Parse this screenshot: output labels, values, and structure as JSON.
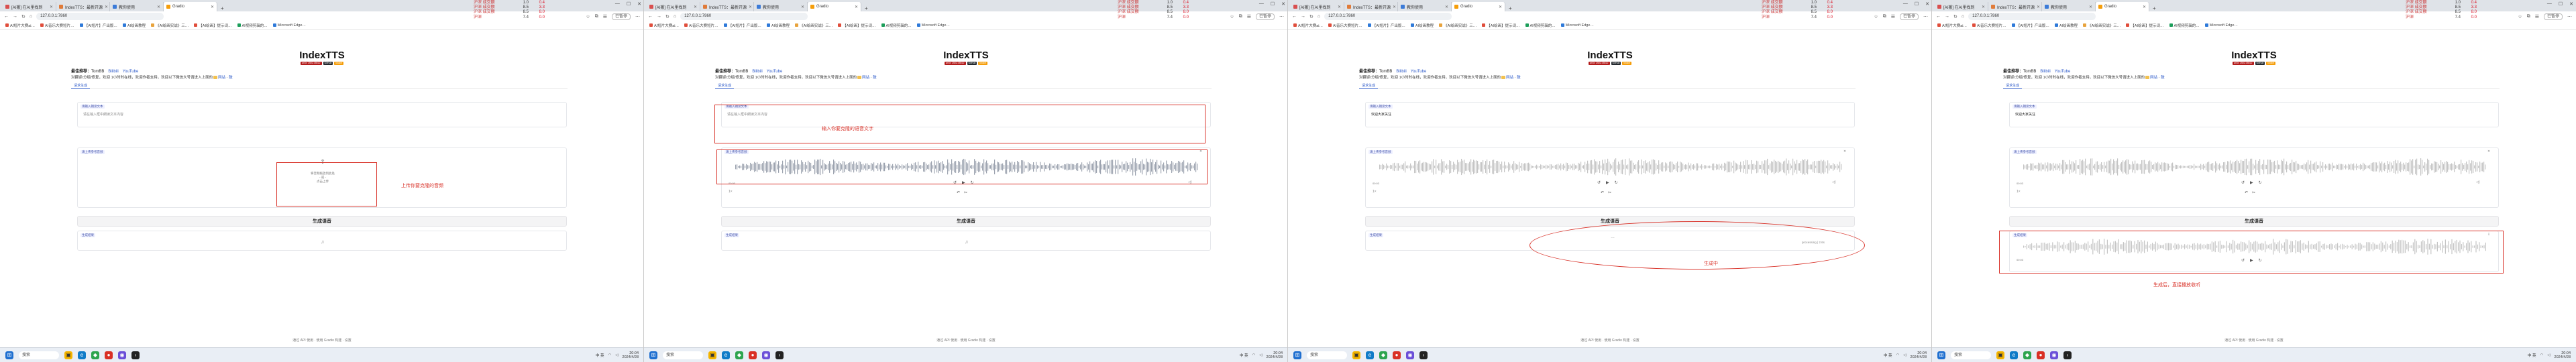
{
  "browser": {
    "tabs": [
      {
        "label": "[AI搬] 在AI里找到"
      },
      {
        "label": "IndexTTS：最新开源"
      },
      {
        "label": "教你使用"
      },
      {
        "label": "Gradio",
        "active": true
      }
    ],
    "new_tab": "+",
    "window_controls": [
      "—",
      "☐",
      "✕"
    ],
    "url": "127.0.0.1:7860",
    "user_label": "已暂停",
    "bookmarks": [
      {
        "label": "AI短片大赛ai…"
      },
      {
        "label": "AI音乐大赛短片…"
      },
      {
        "label": "【AI短片】产出版…"
      },
      {
        "label": "AI绘画教程"
      },
      {
        "label": "《AI绘画实战》三…"
      },
      {
        "label": "【AI绘画】提示词…"
      },
      {
        "label": "AI视频剪辑的…"
      },
      {
        "label": "Microsoft Edge…"
      }
    ]
  },
  "stock_ticker": [
    {
      "name": "沪深 成交额",
      "value": "1.0",
      "pct": "0.4"
    },
    {
      "name": "沪深 成交额",
      "value": "8.5",
      "pct": "3.3"
    },
    {
      "name": "沪深 成交额",
      "value": "8.5",
      "pct": "8.0"
    },
    {
      "name": "沪深",
      "value": "7.4",
      "pct": "0.0"
    }
  ],
  "app": {
    "title": "IndexTTS",
    "badges": [
      "arXiv 2502.05512",
      "GitHub",
      "Model"
    ],
    "intro_label": "最佳推荐：",
    "intro_author": "TomBB",
    "intro_links": [
      "Bilibili",
      "YouTube"
    ],
    "desc_text": "对翻译/分组/修复，欢迎 1小时时在线，欢迎作者支持，欢迎以下微信大号请进入上面的",
    "desc_links": [
      "网站",
      "鼓"
    ],
    "tab_label": "请求生成",
    "ref_label": "请输入朗读文本",
    "ref_placeholder": "请在输入框中朗读文本内容",
    "audio_label": "请上传参考音频",
    "upload_text": "将音频拖放到此处\n- 或 -\n点击上传",
    "generate_label": "生成语音",
    "output_label": "生成结果",
    "footer": "通过 API 使用 · 使用 Gradio 构建 · 设置"
  },
  "panels": [
    {
      "annotation": "上传你要克隆的音频",
      "time": "",
      "text_value": "请在输入框中朗读文本内容"
    },
    {
      "annotation": "输入你要克隆的语音文字",
      "time": "00:00",
      "text_value": "请在输入框中朗读文本内容"
    },
    {
      "annotation": "生成中",
      "time": "00:03",
      "text_value": "欢迎大家关注"
    },
    {
      "annotation": "生成后，直接播放收听",
      "time": "00:03",
      "text_value": "欢迎大家关注"
    }
  ],
  "output_status": {
    "progress": "processing | 2.6s",
    "loading": "…"
  },
  "taskbar": {
    "search_placeholder": "搜索",
    "tray_text": "中 英 ",
    "time_label": "20:04",
    "date_label": "2024/4/28"
  }
}
